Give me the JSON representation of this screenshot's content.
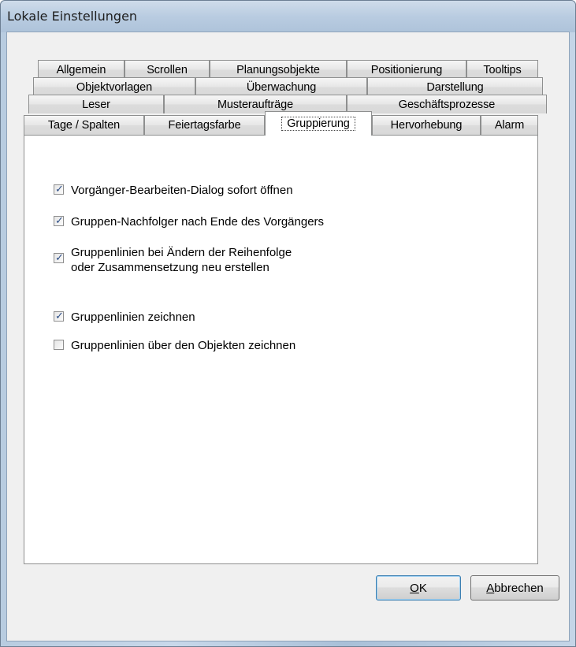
{
  "window": {
    "title": "Lokale Einstellungen"
  },
  "tabs": {
    "row1": [
      "Allgemein",
      "Scrollen",
      "Planungsobjekte",
      "Positionierung",
      "Tooltips"
    ],
    "row2": [
      "Objektvorlagen",
      "Überwachung",
      "Darstellung"
    ],
    "row3": [
      "Leser",
      "Musteraufträge",
      "Geschäftsprozesse"
    ],
    "row4": [
      "Tage / Spalten",
      "Feiertagsfarbe",
      "Gruppierung",
      "Hervorhebung",
      "Alarm"
    ],
    "active": "Gruppierung"
  },
  "options": [
    {
      "label": "Vorgänger-Bearbeiten-Dialog sofort öffnen",
      "checked": true
    },
    {
      "label": "Gruppen-Nachfolger nach Ende des Vorgängers",
      "checked": true
    },
    {
      "label": "Gruppenlinien bei Ändern der Reihenfolge",
      "label2": "oder Zusammensetzung neu erstellen",
      "checked": true
    },
    {
      "label": "Gruppenlinien zeichnen",
      "checked": true
    },
    {
      "label": "Gruppenlinien über den Objekten zeichnen",
      "checked": false
    }
  ],
  "buttons": {
    "ok_mnemonic": "O",
    "ok_rest": "K",
    "cancel_mnemonic": "A",
    "cancel_rest": "bbrechen"
  },
  "icons": {
    "check": "checkmark-icon"
  }
}
